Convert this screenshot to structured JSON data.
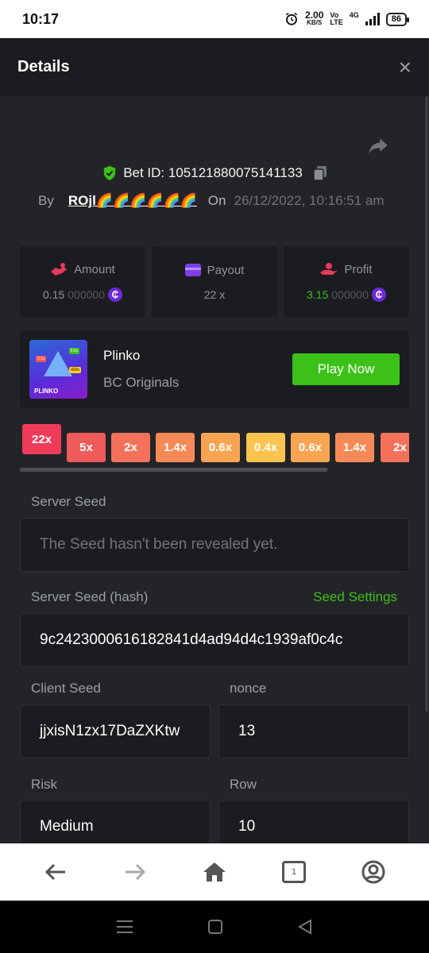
{
  "status_bar": {
    "time": "10:17",
    "net_speed_value": "2.00",
    "net_speed_unit": "KB/S",
    "volte_top": "Vo",
    "volte_bottom": "LTE",
    "network": "4G",
    "battery": "86"
  },
  "modal": {
    "title": "Details",
    "close_label": "×"
  },
  "bet": {
    "bet_id_label": "Bet ID: 105121880075141133",
    "by_label": "By",
    "user": "ROjl🌈🌈🌈🌈🌈🌈",
    "on_label": "On",
    "date": "26/12/2022, 10:16:51 am"
  },
  "stats": {
    "amount": {
      "label": "Amount",
      "value_main": "0.15",
      "value_dim": "000000",
      "icon": "bet-hand-icon",
      "color": "#e8395e"
    },
    "payout": {
      "label": "Payout",
      "value": "22 x",
      "icon": "wallet-icon",
      "color": "#7a3fe6"
    },
    "profit": {
      "label": "Profit",
      "value_main": "3.15",
      "value_dim": "000000",
      "icon": "profit-hand-icon",
      "color": "#e8395e"
    }
  },
  "game": {
    "name": "Plinko",
    "provider": "BC Originals",
    "play_label": "Play Now",
    "thumb_label": "PLINKO",
    "thumb_tags": [
      "2.1x",
      "0.5x",
      "420x"
    ]
  },
  "multipliers": [
    {
      "label": "22x",
      "color": "#ef3b5a"
    },
    {
      "label": "5x",
      "color": "#ef5a5a"
    },
    {
      "label": "2x",
      "color": "#f4725a"
    },
    {
      "label": "1.4x",
      "color": "#f68a56"
    },
    {
      "label": "0.6x",
      "color": "#f8a553"
    },
    {
      "label": "0.4x",
      "color": "#fbc350"
    },
    {
      "label": "0.6x",
      "color": "#f8a553"
    },
    {
      "label": "1.4x",
      "color": "#f68a56"
    },
    {
      "label": "2x",
      "color": "#f4725a"
    }
  ],
  "seeds": {
    "server_seed_label": "Server Seed",
    "server_seed_placeholder": "The Seed hasn't been revealed yet.",
    "server_hash_label": "Server Seed (hash)",
    "seed_settings_label": "Seed Settings",
    "server_hash_value": "9c2423000616182841d4ad94d4c1939af0c4c",
    "client_seed_label": "Client Seed",
    "client_seed_value": "jjxisN1zx17DaZXKtw",
    "nonce_label": "nonce",
    "nonce_value": "13",
    "risk_label": "Risk",
    "risk_value": "Medium",
    "row_label": "Row",
    "row_value": "10"
  },
  "browser_nav": {
    "tab_count": "1"
  }
}
